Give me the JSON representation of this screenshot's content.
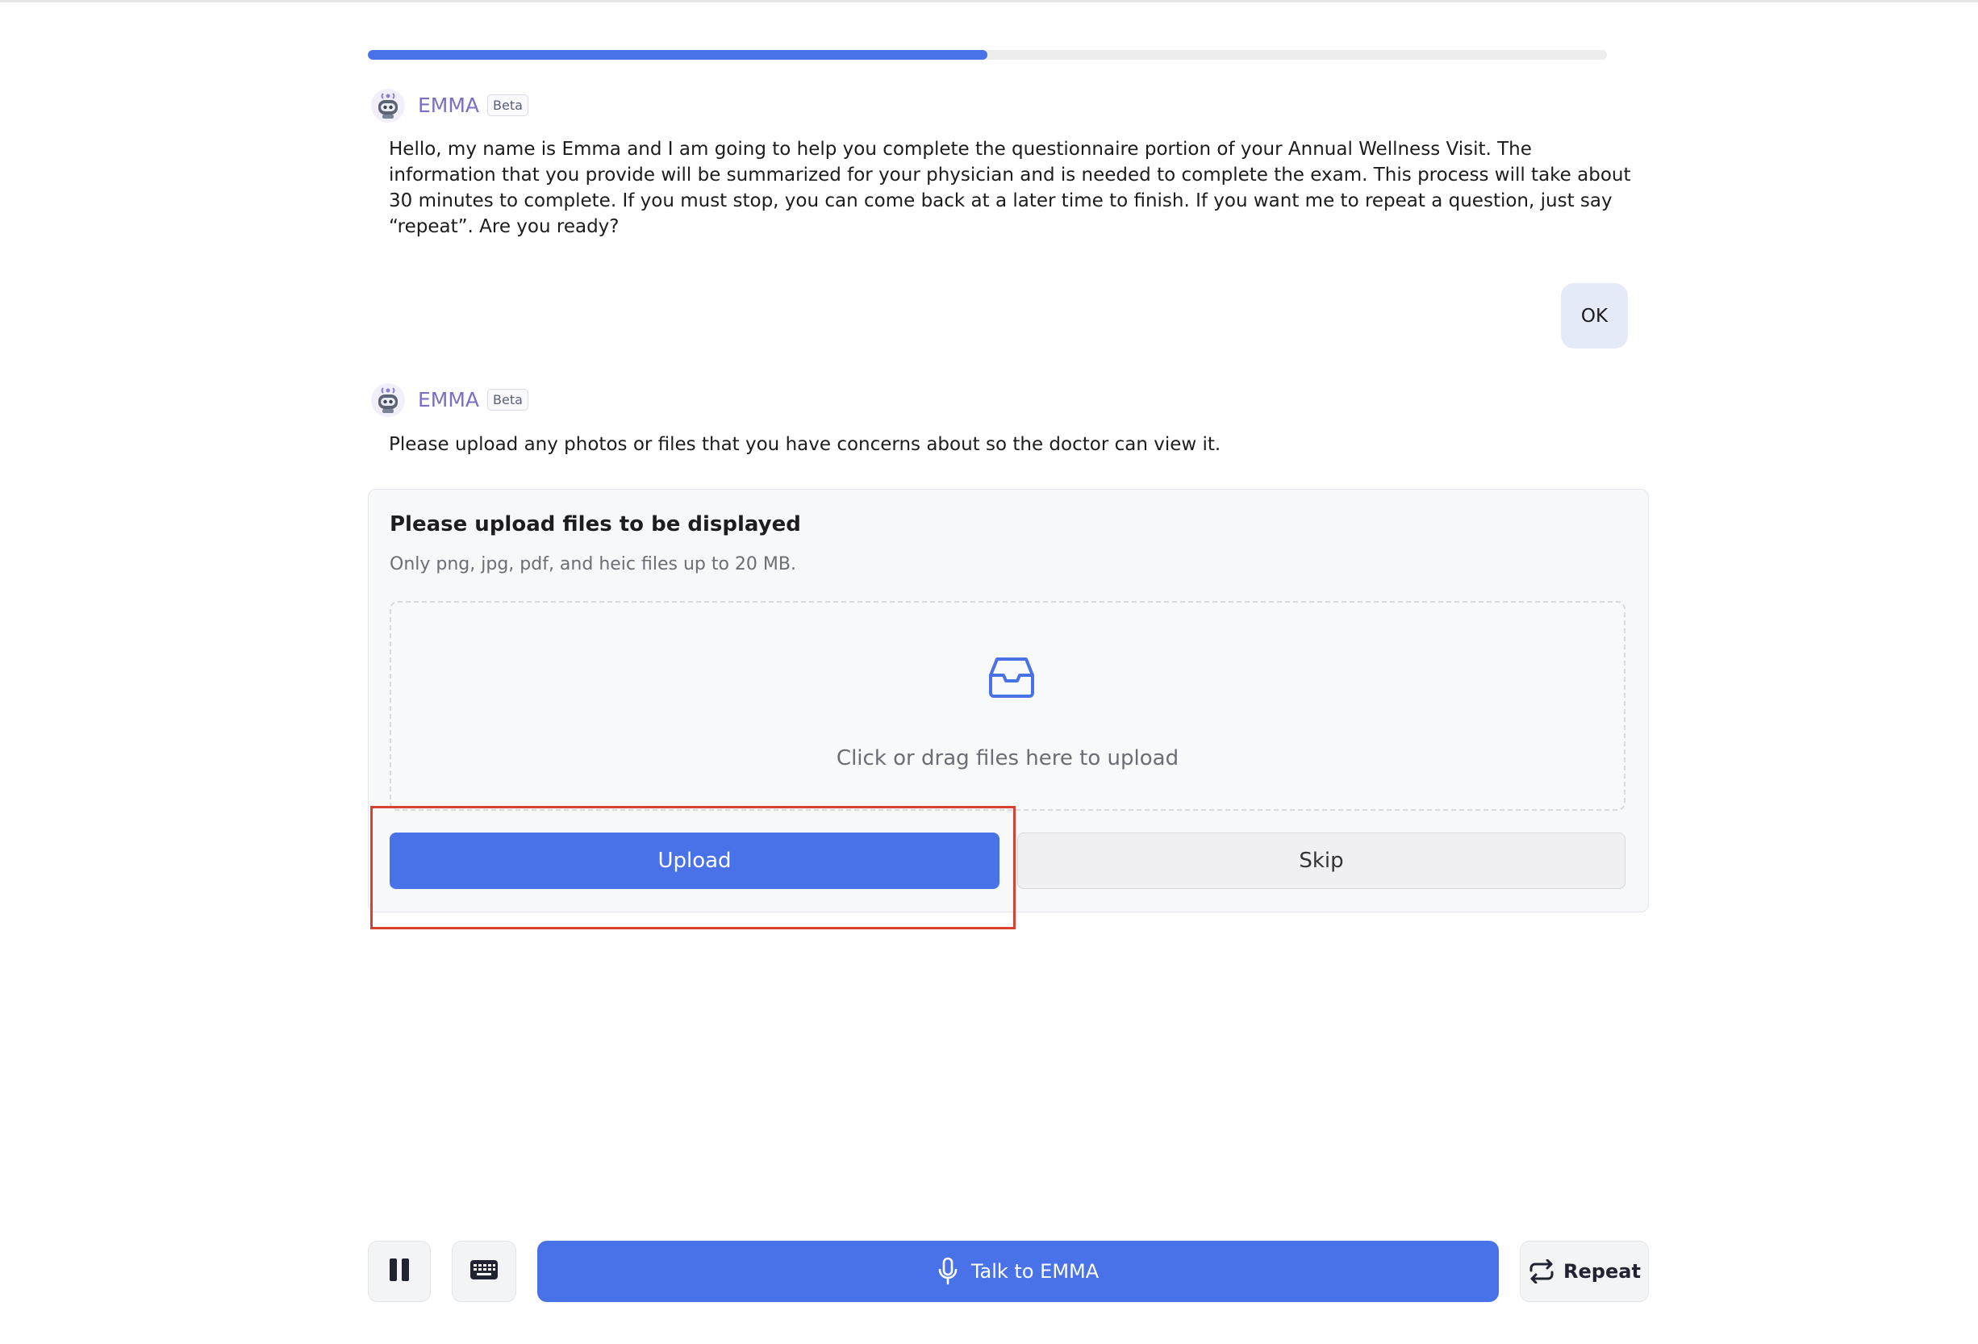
{
  "progress": {
    "fraction": 0.5
  },
  "messages": [
    {
      "sender": "EMMA",
      "badge": "Beta",
      "text": "Hello, my name is Emma and I am going to help you complete the questionnaire portion of your Annual Wellness Visit. The information that you provide will be summarized for your physician and is needed to complete the exam. This process will take about 30 minutes to complete. If you must stop, you can come back at a later time to finish. If you want me to repeat a question, just say “repeat”. Are you ready?"
    },
    {
      "sender": "EMMA",
      "badge": "Beta",
      "text": "Please upload any photos or files that you have concerns about so the doctor can view it."
    }
  ],
  "user_reply": "OK",
  "upload": {
    "title": "Please upload files to be displayed",
    "subtitle": "Only png, jpg, pdf, and heic files up to 20 MB.",
    "dropzone_text": "Click or drag files here to upload",
    "upload_label": "Upload",
    "skip_label": "Skip"
  },
  "controls": {
    "talk_label": "Talk to EMMA",
    "repeat_label": "Repeat",
    "icons": [
      "pause-icon",
      "keyboard-icon",
      "microphone-icon",
      "repeat-icon",
      "inbox-icon",
      "robot-avatar-icon"
    ]
  },
  "colors": {
    "accent": "#4a72e8",
    "sender_name": "#7a6fc2",
    "highlight": "#d8402f",
    "user_bubble": "#e5eaf9"
  }
}
